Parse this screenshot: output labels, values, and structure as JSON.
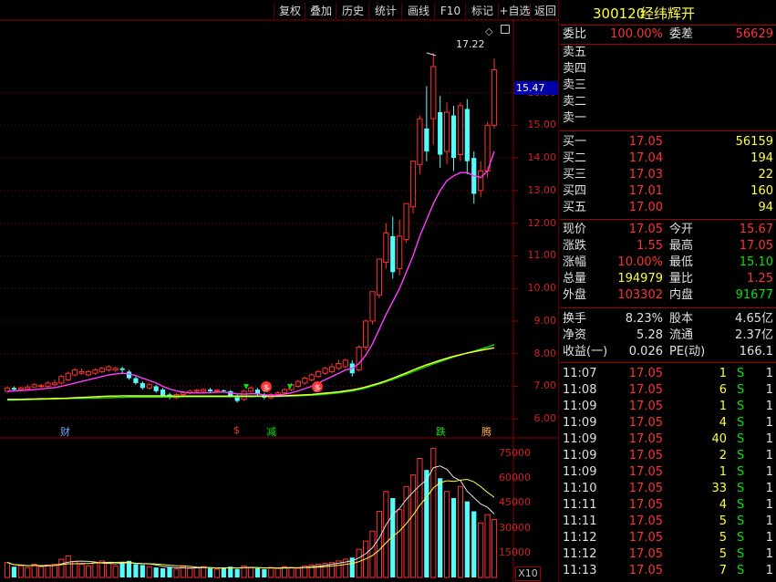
{
  "toolbar": {
    "buttons": [
      "复权",
      "叠加",
      "历史",
      "统计",
      "画线",
      "F10",
      "标记",
      "+自选",
      "返回"
    ]
  },
  "stock": {
    "code": "300120",
    "name": "经纬辉开"
  },
  "chart": {
    "price_axis": [
      "16.00",
      "15.00",
      "14.00",
      "13.00",
      "12.00",
      "11.00",
      "10.00",
      "9.00",
      "8.00",
      "7.00",
      "6.00"
    ],
    "current_price_tag": "15.47",
    "high_marker": "17.22",
    "volume_axis": [
      "75000",
      "60000",
      "45000",
      "30000",
      "15000"
    ],
    "volume_unit": "X10",
    "events": [
      {
        "label": "财",
        "color": "#6fa8ff"
      },
      {
        "label": "$",
        "color": "#ff3232"
      },
      {
        "label": "减",
        "color": "#00e600"
      },
      {
        "label": "跌",
        "color": "#00e600"
      },
      {
        "label": "腾",
        "color": "#ffb040"
      }
    ],
    "badge_glyph": "多",
    "colors": {
      "up": "#ff3232",
      "down": "#54fcfc",
      "ma_short": "#ff3cff",
      "ma_mid": "#ffff3c",
      "ma_long": "#00e600",
      "grid": "#8b0000"
    }
  },
  "chart_data": {
    "type": "candlestick",
    "ylim": [
      5.7,
      18.0
    ],
    "volume_ylim": [
      0,
      80000
    ],
    "candles": [
      {
        "o": 6.85,
        "c": 6.95,
        "h": 7.0,
        "l": 6.8,
        "up": true
      },
      {
        "o": 6.95,
        "c": 6.9,
        "h": 7.0,
        "l": 6.85,
        "up": false
      },
      {
        "o": 6.9,
        "c": 6.95,
        "h": 7.0,
        "l": 6.85,
        "up": true
      },
      {
        "o": 6.92,
        "c": 6.98,
        "h": 7.05,
        "l": 6.9,
        "up": true
      },
      {
        "o": 6.98,
        "c": 7.05,
        "h": 7.1,
        "l": 6.95,
        "up": true
      },
      {
        "o": 7.0,
        "c": 7.02,
        "h": 7.08,
        "l": 6.95,
        "up": true
      },
      {
        "o": 7.0,
        "c": 7.1,
        "h": 7.15,
        "l": 6.95,
        "up": true
      },
      {
        "o": 7.05,
        "c": 7.1,
        "h": 7.2,
        "l": 7.0,
        "up": true
      },
      {
        "o": 7.1,
        "c": 7.3,
        "h": 7.35,
        "l": 7.05,
        "up": true
      },
      {
        "o": 7.2,
        "c": 7.4,
        "h": 7.45,
        "l": 7.15,
        "up": true
      },
      {
        "o": 7.35,
        "c": 7.5,
        "h": 7.55,
        "l": 7.3,
        "up": true
      },
      {
        "o": 7.4,
        "c": 7.45,
        "h": 7.55,
        "l": 7.35,
        "up": true
      },
      {
        "o": 7.35,
        "c": 7.45,
        "h": 7.5,
        "l": 7.3,
        "up": true
      },
      {
        "o": 7.4,
        "c": 7.5,
        "h": 7.55,
        "l": 7.35,
        "up": true
      },
      {
        "o": 7.45,
        "c": 7.55,
        "h": 7.6,
        "l": 7.4,
        "up": true
      },
      {
        "o": 7.5,
        "c": 7.6,
        "h": 7.65,
        "l": 7.45,
        "up": true
      },
      {
        "o": 7.5,
        "c": 7.55,
        "h": 7.6,
        "l": 7.45,
        "up": true
      },
      {
        "o": 7.55,
        "c": 7.5,
        "h": 7.6,
        "l": 7.4,
        "up": false
      },
      {
        "o": 7.45,
        "c": 7.25,
        "h": 7.5,
        "l": 7.2,
        "up": false
      },
      {
        "o": 7.25,
        "c": 7.1,
        "h": 7.3,
        "l": 7.05,
        "up": false
      },
      {
        "o": 7.1,
        "c": 6.95,
        "h": 7.15,
        "l": 6.9,
        "up": false
      },
      {
        "o": 6.95,
        "c": 7.05,
        "h": 7.1,
        "l": 6.9,
        "up": true
      },
      {
        "o": 7.0,
        "c": 6.85,
        "h": 7.05,
        "l": 6.8,
        "up": false
      },
      {
        "o": 6.9,
        "c": 6.7,
        "h": 6.95,
        "l": 6.65,
        "up": false
      },
      {
        "o": 6.75,
        "c": 6.65,
        "h": 6.8,
        "l": 6.6,
        "up": false
      },
      {
        "o": 6.65,
        "c": 6.75,
        "h": 6.8,
        "l": 6.6,
        "up": true
      },
      {
        "o": 6.75,
        "c": 6.8,
        "h": 6.85,
        "l": 6.7,
        "up": true
      },
      {
        "o": 6.8,
        "c": 6.85,
        "h": 6.9,
        "l": 6.75,
        "up": true
      },
      {
        "o": 6.85,
        "c": 6.88,
        "h": 6.92,
        "l": 6.8,
        "up": true
      },
      {
        "o": 6.85,
        "c": 6.9,
        "h": 6.95,
        "l": 6.8,
        "up": true
      },
      {
        "o": 6.9,
        "c": 6.85,
        "h": 6.95,
        "l": 6.82,
        "up": false
      },
      {
        "o": 6.85,
        "c": 6.88,
        "h": 6.92,
        "l": 6.8,
        "up": true
      },
      {
        "o": 6.88,
        "c": 6.85,
        "h": 6.9,
        "l": 6.8,
        "up": false
      },
      {
        "o": 6.85,
        "c": 6.7,
        "h": 6.88,
        "l": 6.65,
        "up": false
      },
      {
        "o": 6.7,
        "c": 6.55,
        "h": 6.75,
        "l": 6.5,
        "up": false
      },
      {
        "o": 6.6,
        "c": 6.85,
        "h": 6.9,
        "l": 6.55,
        "up": true
      },
      {
        "o": 6.85,
        "c": 6.95,
        "h": 7.0,
        "l": 6.8,
        "up": true
      },
      {
        "o": 6.9,
        "c": 6.75,
        "h": 6.95,
        "l": 6.7,
        "up": false
      },
      {
        "o": 6.75,
        "c": 6.65,
        "h": 6.8,
        "l": 6.6,
        "up": false
      },
      {
        "o": 6.65,
        "c": 6.75,
        "h": 6.8,
        "l": 6.6,
        "up": true
      },
      {
        "o": 6.75,
        "c": 6.8,
        "h": 6.85,
        "l": 6.7,
        "up": true
      },
      {
        "o": 6.8,
        "c": 6.9,
        "h": 6.95,
        "l": 6.75,
        "up": true
      },
      {
        "o": 6.9,
        "c": 7.05,
        "h": 7.1,
        "l": 6.85,
        "up": true
      },
      {
        "o": 7.0,
        "c": 7.15,
        "h": 7.2,
        "l": 6.95,
        "up": true
      },
      {
        "o": 7.1,
        "c": 7.25,
        "h": 7.3,
        "l": 7.05,
        "up": true
      },
      {
        "o": 7.2,
        "c": 7.35,
        "h": 7.4,
        "l": 7.15,
        "up": true
      },
      {
        "o": 7.3,
        "c": 7.45,
        "h": 7.5,
        "l": 7.25,
        "up": true
      },
      {
        "o": 7.4,
        "c": 7.55,
        "h": 7.6,
        "l": 7.35,
        "up": true
      },
      {
        "o": 7.45,
        "c": 7.6,
        "h": 7.7,
        "l": 7.4,
        "up": true
      },
      {
        "o": 7.55,
        "c": 7.7,
        "h": 7.8,
        "l": 7.5,
        "up": true
      },
      {
        "o": 7.6,
        "c": 7.8,
        "h": 7.85,
        "l": 7.55,
        "up": true
      },
      {
        "o": 7.7,
        "c": 7.4,
        "h": 7.8,
        "l": 7.3,
        "up": false
      },
      {
        "o": 7.5,
        "c": 8.2,
        "h": 8.25,
        "l": 7.45,
        "up": true
      },
      {
        "o": 8.2,
        "c": 9.0,
        "h": 9.05,
        "l": 8.1,
        "up": true
      },
      {
        "o": 9.0,
        "c": 9.9,
        "h": 9.9,
        "l": 8.9,
        "up": true
      },
      {
        "o": 9.8,
        "c": 10.9,
        "h": 10.9,
        "l": 9.7,
        "up": true
      },
      {
        "o": 10.8,
        "c": 11.7,
        "h": 12.0,
        "l": 10.6,
        "up": true
      },
      {
        "o": 11.6,
        "c": 10.5,
        "h": 12.2,
        "l": 10.3,
        "up": false
      },
      {
        "o": 10.6,
        "c": 11.6,
        "h": 12.1,
        "l": 10.4,
        "up": true
      },
      {
        "o": 11.5,
        "c": 12.6,
        "h": 12.6,
        "l": 11.4,
        "up": true
      },
      {
        "o": 12.5,
        "c": 13.9,
        "h": 13.9,
        "l": 12.3,
        "up": true
      },
      {
        "o": 13.8,
        "c": 15.2,
        "h": 15.3,
        "l": 13.5,
        "up": true
      },
      {
        "o": 14.9,
        "c": 14.2,
        "h": 16.2,
        "l": 13.9,
        "up": false
      },
      {
        "o": 15.2,
        "c": 16.8,
        "h": 17.22,
        "l": 14.4,
        "up": true
      },
      {
        "o": 15.4,
        "c": 14.1,
        "h": 15.9,
        "l": 13.7,
        "up": false
      },
      {
        "o": 14.2,
        "c": 15.4,
        "h": 15.7,
        "l": 13.8,
        "up": true
      },
      {
        "o": 15.3,
        "c": 14.0,
        "h": 15.6,
        "l": 13.6,
        "up": false
      },
      {
        "o": 14.1,
        "c": 15.6,
        "h": 15.7,
        "l": 13.9,
        "up": true
      },
      {
        "o": 15.5,
        "c": 13.9,
        "h": 15.8,
        "l": 13.5,
        "up": false
      },
      {
        "o": 14.0,
        "c": 12.9,
        "h": 14.2,
        "l": 12.6,
        "up": false
      },
      {
        "o": 13.0,
        "c": 13.6,
        "h": 13.9,
        "l": 12.8,
        "up": true
      },
      {
        "o": 13.6,
        "c": 15.0,
        "h": 15.1,
        "l": 13.4,
        "up": true
      },
      {
        "o": 15.0,
        "c": 16.7,
        "h": 17.05,
        "l": 14.9,
        "up": true
      }
    ],
    "volumes": [
      9000,
      6500,
      7000,
      6000,
      8000,
      6500,
      7500,
      8000,
      11000,
      13000,
      9500,
      8000,
      7000,
      9000,
      10000,
      8500,
      7000,
      9000,
      10000,
      8000,
      7500,
      6500,
      6000,
      5500,
      6000,
      5000,
      6500,
      5500,
      6000,
      6500,
      5500,
      5000,
      6000,
      6500,
      5000,
      7000,
      6000,
      5500,
      5000,
      6000,
      5500,
      6500,
      6000,
      5500,
      7000,
      7500,
      8000,
      8500,
      9000,
      10000,
      11000,
      12000,
      17000,
      22000,
      28000,
      40000,
      52000,
      48000,
      41000,
      55000,
      62000,
      72000,
      65000,
      78000,
      60000,
      52000,
      48000,
      55000,
      46000,
      40000,
      33000,
      38000,
      35000
    ],
    "ma_short": [
      6.85,
      6.86,
      6.87,
      6.88,
      6.9,
      6.92,
      6.94,
      6.96,
      7.0,
      7.05,
      7.1,
      7.15,
      7.2,
      7.25,
      7.3,
      7.35,
      7.38,
      7.4,
      7.38,
      7.33,
      7.25,
      7.18,
      7.1,
      7.0,
      6.92,
      6.86,
      6.82,
      6.8,
      6.8,
      6.8,
      6.81,
      6.82,
      6.82,
      6.8,
      6.77,
      6.76,
      6.77,
      6.77,
      6.74,
      6.72,
      6.73,
      6.76,
      6.8,
      6.86,
      6.93,
      7.0,
      7.1,
      7.2,
      7.3,
      7.4,
      7.5,
      7.55,
      7.7,
      7.95,
      8.3,
      8.75,
      9.2,
      9.6,
      10.0,
      10.5,
      11.0,
      11.6,
      12.1,
      12.6,
      13.0,
      13.3,
      13.45,
      13.55,
      13.55,
      13.45,
      13.4,
      13.6,
      14.2
    ],
    "ma_mid": [
      6.6,
      6.6,
      6.6,
      6.61,
      6.61,
      6.62,
      6.62,
      6.63,
      6.63,
      6.64,
      6.65,
      6.66,
      6.67,
      6.68,
      6.69,
      6.7,
      6.7,
      6.71,
      6.71,
      6.71,
      6.71,
      6.71,
      6.71,
      6.71,
      6.7,
      6.7,
      6.7,
      6.7,
      6.7,
      6.7,
      6.7,
      6.7,
      6.7,
      6.7,
      6.7,
      6.7,
      6.7,
      6.7,
      6.7,
      6.7,
      6.7,
      6.71,
      6.72,
      6.73,
      6.74,
      6.75,
      6.77,
      6.79,
      6.81,
      6.83,
      6.86,
      6.89,
      6.93,
      6.98,
      7.04,
      7.1,
      7.17,
      7.25,
      7.33,
      7.41,
      7.5,
      7.58,
      7.66,
      7.73,
      7.8,
      7.86,
      7.92,
      7.97,
      8.02,
      8.06,
      8.1,
      8.14,
      8.18
    ],
    "ma_long": [
      6.58,
      6.58,
      6.59,
      6.59,
      6.6,
      6.6,
      6.61,
      6.61,
      6.62,
      6.62,
      6.63,
      6.63,
      6.64,
      6.64,
      6.65,
      6.65,
      6.66,
      6.66,
      6.67,
      6.67,
      6.67,
      6.67,
      6.67,
      6.67,
      6.67,
      6.67,
      6.68,
      6.68,
      6.68,
      6.68,
      6.68,
      6.68,
      6.68,
      6.68,
      6.68,
      6.68,
      6.68,
      6.69,
      6.69,
      6.69,
      6.69,
      6.7,
      6.7,
      6.71,
      6.72,
      6.73,
      6.74,
      6.76,
      6.78,
      6.8,
      6.83,
      6.86,
      6.9,
      6.95,
      7.01,
      7.07,
      7.14,
      7.21,
      7.29,
      7.37,
      7.45,
      7.53,
      7.61,
      7.69,
      7.76,
      7.83,
      7.9,
      7.96,
      8.02,
      8.08,
      8.14,
      8.2,
      8.28
    ]
  },
  "quote": {
    "weibi_label": "委比",
    "weibi": "100.00%",
    "weicha_label": "委差",
    "weicha": "56629",
    "asks": [
      {
        "label": "卖五",
        "price": "",
        "vol": ""
      },
      {
        "label": "卖四",
        "price": "",
        "vol": ""
      },
      {
        "label": "卖三",
        "price": "",
        "vol": ""
      },
      {
        "label": "卖二",
        "price": "",
        "vol": ""
      },
      {
        "label": "卖一",
        "price": "",
        "vol": ""
      }
    ],
    "bids": [
      {
        "label": "买一",
        "price": "17.05",
        "vol": "56159"
      },
      {
        "label": "买二",
        "price": "17.04",
        "vol": "194"
      },
      {
        "label": "买三",
        "price": "17.03",
        "vol": "22"
      },
      {
        "label": "买四",
        "price": "17.01",
        "vol": "160"
      },
      {
        "label": "买五",
        "price": "17.00",
        "vol": "94"
      }
    ],
    "stats": [
      {
        "l1": "现价",
        "v1": "17.05",
        "l2": "今开",
        "v2": "15.67",
        "c2": "red"
      },
      {
        "l1": "涨跌",
        "v1": "1.55",
        "l2": "最高",
        "v2": "17.05",
        "c2": "red"
      },
      {
        "l1": "涨幅",
        "v1": "10.00%",
        "l2": "最低",
        "v2": "15.10",
        "c2": "green"
      },
      {
        "l1": "总量",
        "v1": "194979",
        "l2": "量比",
        "v2": "1.25",
        "c2": "red",
        "c1": "yellow"
      },
      {
        "l1": "外盘",
        "v1": "103302",
        "l2": "内盘",
        "v2": "91677",
        "c2": "green"
      }
    ],
    "fund": [
      {
        "l1": "换手",
        "v1": "8.23%",
        "l2": "股本",
        "v2": "4.65亿"
      },
      {
        "l1": "净资",
        "v1": "5.28",
        "l2": "流通",
        "v2": "2.37亿"
      },
      {
        "l1": "收益(一)",
        "v1": "0.026",
        "l2": "PE(动)",
        "v2": "166.1"
      }
    ]
  },
  "ticks": [
    {
      "time": "11:07",
      "price": "17.05",
      "vol": "1",
      "side": "S",
      "n": "1"
    },
    {
      "time": "11:08",
      "price": "17.05",
      "vol": "6",
      "side": "S",
      "n": "1"
    },
    {
      "time": "11:09",
      "price": "17.05",
      "vol": "1",
      "side": "S",
      "n": "1"
    },
    {
      "time": "11:09",
      "price": "17.05",
      "vol": "4",
      "side": "S",
      "n": "1"
    },
    {
      "time": "11:09",
      "price": "17.05",
      "vol": "40",
      "side": "S",
      "n": "1"
    },
    {
      "time": "11:09",
      "price": "17.05",
      "vol": "2",
      "side": "S",
      "n": "1"
    },
    {
      "time": "11:09",
      "price": "17.05",
      "vol": "1",
      "side": "S",
      "n": "1"
    },
    {
      "time": "11:10",
      "price": "17.05",
      "vol": "33",
      "side": "S",
      "n": "1"
    },
    {
      "time": "11:11",
      "price": "17.05",
      "vol": "4",
      "side": "S",
      "n": "1"
    },
    {
      "time": "11:11",
      "price": "17.05",
      "vol": "5",
      "side": "S",
      "n": "1"
    },
    {
      "time": "11:12",
      "price": "17.05",
      "vol": "5",
      "side": "S",
      "n": "1"
    },
    {
      "time": "11:12",
      "price": "17.05",
      "vol": "5",
      "side": "S",
      "n": "1"
    },
    {
      "time": "11:13",
      "price": "17.05",
      "vol": "7",
      "side": "S",
      "n": "1"
    }
  ]
}
